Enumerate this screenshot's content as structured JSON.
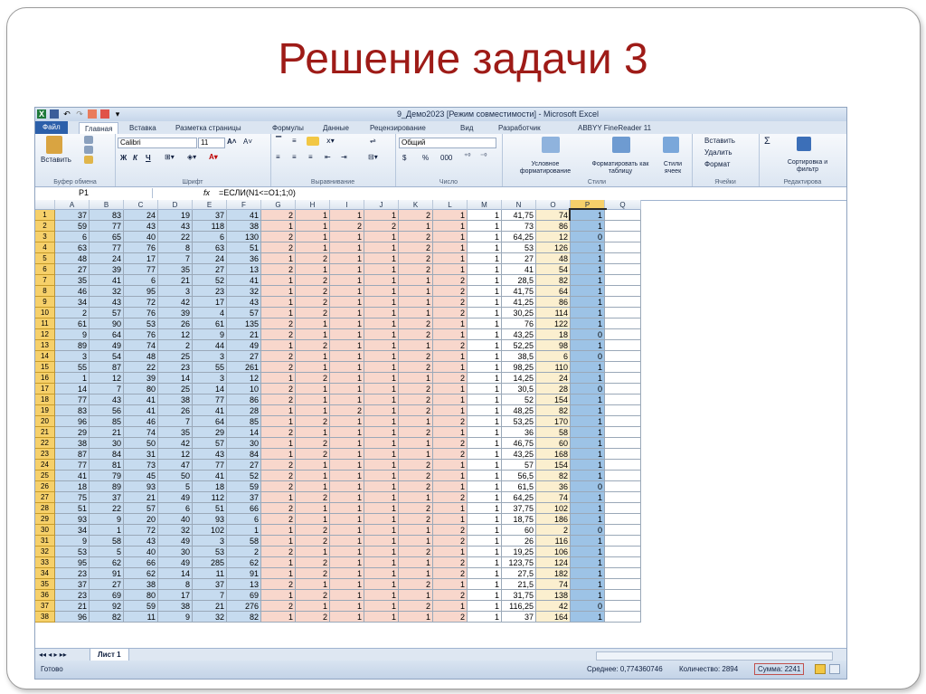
{
  "slide": {
    "title": "Решение задачи 3"
  },
  "window": {
    "title": "9_Демо2023  [Режим совместимости]  -  Microsoft Excel",
    "tabs": [
      "Файл",
      "Главная",
      "Вставка",
      "Разметка страницы",
      "Формулы",
      "Данные",
      "Рецензирование",
      "Вид",
      "Разработчик",
      "ABBYY FineReader 11"
    ],
    "active_tab": "Главная"
  },
  "ribbon": {
    "paste": "Вставить",
    "clipboard": "Буфер обмена",
    "font_name": "Calibri",
    "font_size": "11",
    "bold": "Ж",
    "italic": "К",
    "underline": "Ч",
    "font_group": "Шрифт",
    "align_group": "Выравнивание",
    "number_format": "Общий",
    "number_group": "Число",
    "conditional": "Условное форматирование",
    "format_table": "Форматировать как таблицу",
    "cell_styles": "Стили ячеек",
    "styles_group": "Стили",
    "insert": "Вставить",
    "delete": "Удалить",
    "format": "Формат",
    "cells_group": "Ячейки",
    "sort": "Сортировка и фильтр",
    "editing_group": "Редактирова",
    "sum_symbol": "Σ",
    "percent": "%",
    "thousands": "000",
    "currency": "$"
  },
  "formula_bar": {
    "name_box": "P1",
    "fx": "fx",
    "formula": "=ЕСЛИ(N1<=O1;1;0)"
  },
  "columns": [
    "A",
    "B",
    "C",
    "D",
    "E",
    "F",
    "G",
    "H",
    "I",
    "J",
    "K",
    "L",
    "M",
    "N",
    "O",
    "P",
    "Q"
  ],
  "rows": [
    [
      37,
      83,
      24,
      19,
      37,
      41,
      2,
      1,
      1,
      1,
      2,
      1,
      1,
      "41,75",
      74,
      1
    ],
    [
      59,
      77,
      43,
      43,
      118,
      38,
      1,
      1,
      2,
      2,
      1,
      1,
      1,
      "73",
      86,
      1
    ],
    [
      6,
      65,
      40,
      22,
      6,
      130,
      2,
      1,
      1,
      1,
      2,
      1,
      1,
      "64,25",
      12,
      0
    ],
    [
      63,
      77,
      76,
      8,
      63,
      51,
      2,
      1,
      1,
      1,
      2,
      1,
      1,
      "53",
      126,
      1
    ],
    [
      48,
      24,
      17,
      7,
      24,
      36,
      1,
      2,
      1,
      1,
      2,
      1,
      1,
      "27",
      48,
      1
    ],
    [
      27,
      39,
      77,
      35,
      27,
      13,
      2,
      1,
      1,
      1,
      2,
      1,
      1,
      "41",
      54,
      1
    ],
    [
      35,
      41,
      6,
      21,
      52,
      41,
      1,
      2,
      1,
      1,
      1,
      2,
      1,
      "28,5",
      82,
      1
    ],
    [
      46,
      32,
      95,
      3,
      23,
      32,
      1,
      2,
      1,
      1,
      1,
      2,
      1,
      "41,75",
      64,
      1
    ],
    [
      34,
      43,
      72,
      42,
      17,
      43,
      1,
      2,
      1,
      1,
      1,
      2,
      1,
      "41,25",
      86,
      1
    ],
    [
      2,
      57,
      76,
      39,
      4,
      57,
      1,
      2,
      1,
      1,
      1,
      2,
      1,
      "30,25",
      114,
      1
    ],
    [
      61,
      90,
      53,
      26,
      61,
      135,
      2,
      1,
      1,
      1,
      2,
      1,
      1,
      "76",
      122,
      1
    ],
    [
      9,
      64,
      76,
      12,
      9,
      21,
      2,
      1,
      1,
      1,
      2,
      1,
      1,
      "43,25",
      18,
      0
    ],
    [
      89,
      49,
      74,
      2,
      44,
      49,
      1,
      2,
      1,
      1,
      1,
      2,
      1,
      "52,25",
      98,
      1
    ],
    [
      3,
      54,
      48,
      25,
      3,
      27,
      2,
      1,
      1,
      1,
      2,
      1,
      1,
      "38,5",
      6,
      0
    ],
    [
      55,
      87,
      22,
      23,
      55,
      261,
      2,
      1,
      1,
      1,
      2,
      1,
      1,
      "98,25",
      110,
      1
    ],
    [
      1,
      12,
      39,
      14,
      3,
      12,
      1,
      2,
      1,
      1,
      1,
      2,
      1,
      "14,25",
      24,
      1
    ],
    [
      14,
      7,
      80,
      25,
      14,
      10,
      2,
      1,
      1,
      1,
      2,
      1,
      1,
      "30,5",
      28,
      0
    ],
    [
      77,
      43,
      41,
      38,
      77,
      86,
      2,
      1,
      1,
      1,
      2,
      1,
      1,
      "52",
      154,
      1
    ],
    [
      83,
      56,
      41,
      26,
      41,
      28,
      1,
      1,
      2,
      1,
      2,
      1,
      1,
      "48,25",
      82,
      1
    ],
    [
      96,
      85,
      46,
      7,
      64,
      85,
      1,
      2,
      1,
      1,
      1,
      2,
      1,
      "53,25",
      170,
      1
    ],
    [
      29,
      21,
      74,
      35,
      29,
      14,
      2,
      1,
      1,
      1,
      2,
      1,
      1,
      "36",
      58,
      1
    ],
    [
      38,
      30,
      50,
      42,
      57,
      30,
      1,
      2,
      1,
      1,
      1,
      2,
      1,
      "46,75",
      60,
      1
    ],
    [
      87,
      84,
      31,
      12,
      43,
      84,
      1,
      2,
      1,
      1,
      1,
      2,
      1,
      "43,25",
      168,
      1
    ],
    [
      77,
      81,
      73,
      47,
      77,
      27,
      2,
      1,
      1,
      1,
      2,
      1,
      1,
      "57",
      154,
      1
    ],
    [
      41,
      79,
      45,
      50,
      41,
      52,
      2,
      1,
      1,
      1,
      2,
      1,
      1,
      "56,5",
      82,
      1
    ],
    [
      18,
      89,
      93,
      5,
      18,
      59,
      2,
      1,
      1,
      1,
      2,
      1,
      1,
      "61,5",
      36,
      0
    ],
    [
      75,
      37,
      21,
      49,
      112,
      37,
      1,
      2,
      1,
      1,
      1,
      2,
      1,
      "64,25",
      74,
      1
    ],
    [
      51,
      22,
      57,
      6,
      51,
      66,
      2,
      1,
      1,
      1,
      2,
      1,
      1,
      "37,75",
      102,
      1
    ],
    [
      93,
      9,
      20,
      40,
      93,
      6,
      2,
      1,
      1,
      1,
      2,
      1,
      1,
      "18,75",
      186,
      1
    ],
    [
      34,
      1,
      72,
      32,
      102,
      1,
      1,
      2,
      1,
      1,
      1,
      2,
      1,
      "60",
      2,
      0
    ],
    [
      9,
      58,
      43,
      49,
      3,
      58,
      1,
      2,
      1,
      1,
      1,
      2,
      1,
      "26",
      116,
      1
    ],
    [
      53,
      5,
      40,
      30,
      53,
      2,
      2,
      1,
      1,
      1,
      2,
      1,
      1,
      "19,25",
      106,
      1
    ],
    [
      95,
      62,
      66,
      49,
      285,
      62,
      1,
      2,
      1,
      1,
      1,
      2,
      1,
      "123,75",
      124,
      1
    ],
    [
      23,
      91,
      62,
      14,
      11,
      91,
      1,
      2,
      1,
      1,
      1,
      2,
      1,
      "27,5",
      182,
      1
    ],
    [
      37,
      27,
      38,
      8,
      37,
      13,
      2,
      1,
      1,
      1,
      2,
      1,
      1,
      "21,5",
      74,
      1
    ],
    [
      23,
      69,
      80,
      17,
      7,
      69,
      1,
      2,
      1,
      1,
      1,
      2,
      1,
      "31,75",
      138,
      1
    ],
    [
      21,
      92,
      59,
      38,
      21,
      276,
      2,
      1,
      1,
      1,
      2,
      1,
      1,
      "116,25",
      42,
      0
    ],
    [
      96,
      82,
      11,
      9,
      32,
      82,
      1,
      2,
      1,
      1,
      1,
      2,
      1,
      "37",
      164,
      1
    ]
  ],
  "sheet": {
    "tab": "Лист 1"
  },
  "statusbar": {
    "ready": "Готово",
    "average": "Среднее: 0,774360746",
    "count": "Количество: 2894",
    "sum": "Сумма: 2241"
  },
  "colors": {
    "title": "#9e1b17",
    "blue_cols": "#c6dbef",
    "pink_cols": "#f8d7cc",
    "p_col": "#9dc3e6",
    "o_col": "#fbefcf",
    "row_header": "#f6d06a"
  }
}
